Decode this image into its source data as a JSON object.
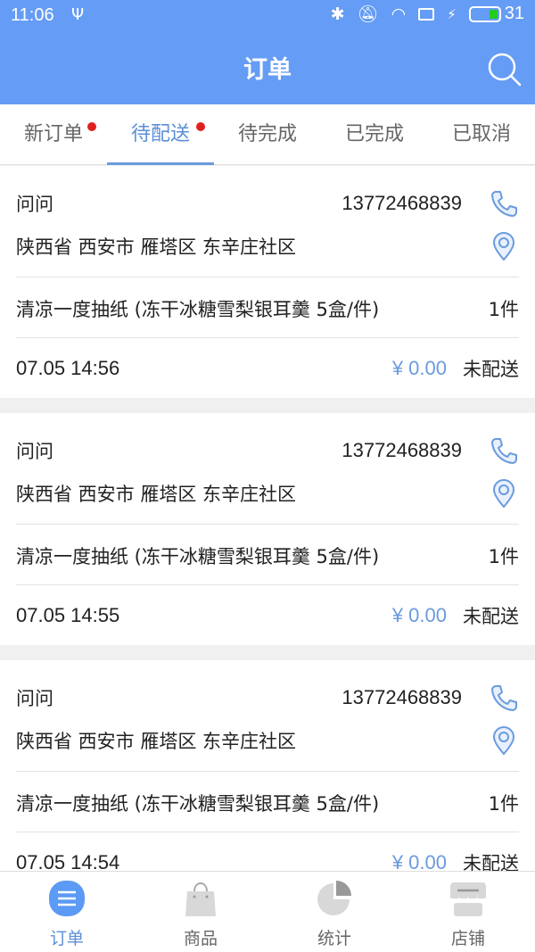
{
  "status_bar": {
    "time": "11:06",
    "battery": "31"
  },
  "header": {
    "title": "订单"
  },
  "tabs": [
    {
      "label": "新订单",
      "badge": true,
      "active": false
    },
    {
      "label": "待配送",
      "badge": true,
      "active": true
    },
    {
      "label": "待完成",
      "badge": false,
      "active": false
    },
    {
      "label": "已完成",
      "badge": false,
      "active": false
    },
    {
      "label": "已取消",
      "badge": false,
      "active": false
    }
  ],
  "orders": [
    {
      "name": "问问",
      "phone": "13772468839",
      "address": "陕西省 西安市 雁塔区 东辛庄社区",
      "product": "清凉一度抽纸 (冻干冰糖雪梨银耳羹 5盒/件)",
      "quantity": "1件",
      "datetime": "07.05 14:56",
      "price": "¥ 0.00",
      "status": "未配送"
    },
    {
      "name": "问问",
      "phone": "13772468839",
      "address": "陕西省 西安市 雁塔区 东辛庄社区",
      "product": "清凉一度抽纸 (冻干冰糖雪梨银耳羹 5盒/件)",
      "quantity": "1件",
      "datetime": "07.05 14:55",
      "price": "¥ 0.00",
      "status": "未配送"
    },
    {
      "name": "问问",
      "phone": "13772468839",
      "address": "陕西省 西安市 雁塔区 东辛庄社区",
      "product": "清凉一度抽纸 (冻干冰糖雪梨银耳羹 5盒/件)",
      "quantity": "1件",
      "datetime": "07.05 14:54",
      "price": "¥ 0.00",
      "status": "未配送"
    }
  ],
  "bottom_nav": [
    {
      "label": "订单",
      "icon": "order-list-icon",
      "active": true
    },
    {
      "label": "商品",
      "icon": "shopping-bag-icon",
      "active": false
    },
    {
      "label": "统计",
      "icon": "pie-chart-icon",
      "active": false
    },
    {
      "label": "店铺",
      "icon": "store-icon",
      "active": false
    }
  ],
  "colors": {
    "primary": "#659cf5",
    "accent": "#5b8fd6",
    "badge": "#e02020"
  }
}
